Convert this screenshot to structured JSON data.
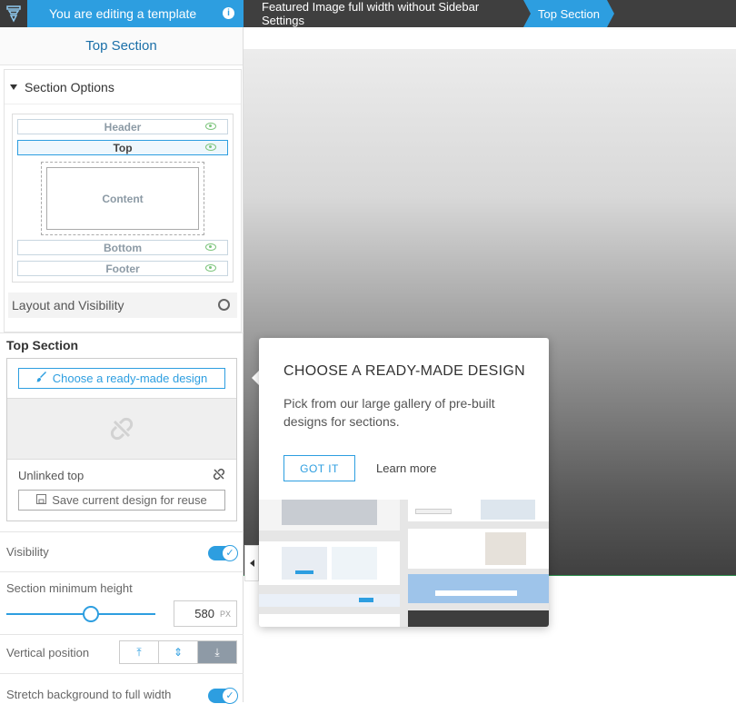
{
  "topbar": {
    "editing_label": "You are editing a template",
    "info_icon": "info-icon",
    "breadcrumb": [
      "Featured Image full width without Sidebar Settings",
      "Top Section"
    ]
  },
  "sidebar": {
    "panel_title": "Top Section",
    "section_options": {
      "title": "Section Options",
      "slots": [
        "Header",
        "Top",
        "Content",
        "Bottom",
        "Footer"
      ],
      "layout_visibility": "Layout and Visibility"
    },
    "top_section": {
      "label": "Top Section",
      "choose_button": "Choose a ready-made design",
      "unlinked_label": "Unlinked top",
      "save_button": "Save current design for reuse"
    },
    "visibility_label": "Visibility",
    "visibility_on": true,
    "min_height_label": "Section minimum height",
    "min_height_value": "580",
    "min_height_unit": "PX",
    "min_height_fraction": 0.57,
    "vertical_position_label": "Vertical position",
    "stretch_label": "Stretch background to full width"
  },
  "popup": {
    "title": "CHOOSE A READY-MADE DESIGN",
    "body": "Pick from our large gallery of pre-built designs for sections.",
    "got_it": "GOT IT",
    "learn_more": "Learn more"
  },
  "colors": {
    "accent": "#2d9ee0",
    "topbar": "#3f3f3f"
  }
}
